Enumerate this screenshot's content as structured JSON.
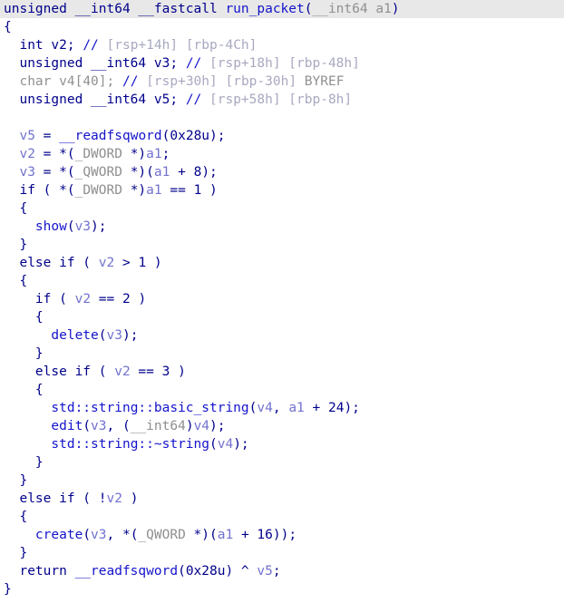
{
  "view": {
    "name": "hex-rays-pseudocode",
    "background": "#ffffff",
    "current_line_highlight": "#e8e8e8",
    "font_size_px": 14.5,
    "line_height_px": 20
  },
  "colors": {
    "keyword": "#00008b",
    "number": "#00008b",
    "punctuation": "#00008b",
    "function": "#1414cc",
    "variable": "#7272cf",
    "pseudotype": "#8f8f8f",
    "comment": "#a8a8c0",
    "dimmed": "#909090"
  },
  "function": {
    "return_type": "unsigned __int64",
    "calling_convention": "__fastcall",
    "name": "run_packet",
    "parameter": "__int64 a1"
  },
  "lines": [
    {
      "n": 1,
      "current": true,
      "tokens": [
        {
          "t": "unsigned __int64 ",
          "c": "kw"
        },
        {
          "t": "__fastcall ",
          "c": "kw"
        },
        {
          "t": "run_packet",
          "c": "fn"
        },
        {
          "t": "(",
          "c": "punc"
        },
        {
          "t": "__int64 ",
          "c": "dim"
        },
        {
          "t": "a1",
          "c": "dim"
        },
        {
          "t": ")",
          "c": "punc"
        }
      ]
    },
    {
      "n": 2,
      "current": false,
      "tokens": [
        {
          "t": "{",
          "c": "punc"
        }
      ]
    },
    {
      "n": 3,
      "current": false,
      "tokens": [
        {
          "t": "  ",
          "c": "plain"
        },
        {
          "t": "int ",
          "c": "kw"
        },
        {
          "t": "v2",
          "c": "kw"
        },
        {
          "t": "; ",
          "c": "punc"
        },
        {
          "t": "//",
          "c": "fn"
        },
        {
          "t": " [rsp+14h] [rbp-4Ch]",
          "c": "cmt"
        }
      ]
    },
    {
      "n": 4,
      "current": false,
      "tokens": [
        {
          "t": "  ",
          "c": "plain"
        },
        {
          "t": "unsigned __int64 ",
          "c": "kw"
        },
        {
          "t": "v3",
          "c": "kw"
        },
        {
          "t": "; ",
          "c": "punc"
        },
        {
          "t": "//",
          "c": "fn"
        },
        {
          "t": " [rsp+18h] [rbp-48h]",
          "c": "cmt"
        }
      ]
    },
    {
      "n": 5,
      "current": false,
      "tokens": [
        {
          "t": "  ",
          "c": "plain"
        },
        {
          "t": "char ",
          "c": "dim"
        },
        {
          "t": "v4[40]",
          "c": "dim"
        },
        {
          "t": "; ",
          "c": "dim"
        },
        {
          "t": "//",
          "c": "fn"
        },
        {
          "t": " [rsp+30h] [rbp-30h] ",
          "c": "cmt"
        },
        {
          "t": "BYREF",
          "c": "dim"
        }
      ]
    },
    {
      "n": 6,
      "current": false,
      "tokens": [
        {
          "t": "  ",
          "c": "plain"
        },
        {
          "t": "unsigned __int64 ",
          "c": "kw"
        },
        {
          "t": "v5",
          "c": "kw"
        },
        {
          "t": "; ",
          "c": "punc"
        },
        {
          "t": "//",
          "c": "fn"
        },
        {
          "t": " [rsp+58h] [rbp-8h]",
          "c": "cmt"
        }
      ]
    },
    {
      "n": 7,
      "current": false,
      "tokens": [
        {
          "t": "",
          "c": "plain"
        }
      ]
    },
    {
      "n": 8,
      "current": false,
      "tokens": [
        {
          "t": "  ",
          "c": "plain"
        },
        {
          "t": "v5",
          "c": "var"
        },
        {
          "t": " = ",
          "c": "punc"
        },
        {
          "t": "__readfsqword",
          "c": "fn"
        },
        {
          "t": "(",
          "c": "punc"
        },
        {
          "t": "0x28u",
          "c": "num"
        },
        {
          "t": ");",
          "c": "punc"
        }
      ]
    },
    {
      "n": 9,
      "current": false,
      "tokens": [
        {
          "t": "  ",
          "c": "plain"
        },
        {
          "t": "v2",
          "c": "var"
        },
        {
          "t": " = *(",
          "c": "punc"
        },
        {
          "t": "_DWORD ",
          "c": "type"
        },
        {
          "t": "*)",
          "c": "punc"
        },
        {
          "t": "a1",
          "c": "var"
        },
        {
          "t": ";",
          "c": "punc"
        }
      ]
    },
    {
      "n": 10,
      "current": false,
      "tokens": [
        {
          "t": "  ",
          "c": "plain"
        },
        {
          "t": "v3",
          "c": "var"
        },
        {
          "t": " = *(",
          "c": "punc"
        },
        {
          "t": "_QWORD ",
          "c": "type"
        },
        {
          "t": "*)(",
          "c": "punc"
        },
        {
          "t": "a1",
          "c": "var"
        },
        {
          "t": " + ",
          "c": "punc"
        },
        {
          "t": "8",
          "c": "num"
        },
        {
          "t": ");",
          "c": "punc"
        }
      ]
    },
    {
      "n": 11,
      "current": false,
      "tokens": [
        {
          "t": "  ",
          "c": "plain"
        },
        {
          "t": "if",
          "c": "kw"
        },
        {
          "t": " ( *(",
          "c": "punc"
        },
        {
          "t": "_DWORD ",
          "c": "type"
        },
        {
          "t": "*)",
          "c": "punc"
        },
        {
          "t": "a1",
          "c": "var"
        },
        {
          "t": " == ",
          "c": "punc"
        },
        {
          "t": "1",
          "c": "num"
        },
        {
          "t": " )",
          "c": "punc"
        }
      ]
    },
    {
      "n": 12,
      "current": false,
      "tokens": [
        {
          "t": "  ",
          "c": "plain"
        },
        {
          "t": "{",
          "c": "punc"
        }
      ]
    },
    {
      "n": 13,
      "current": false,
      "tokens": [
        {
          "t": "    ",
          "c": "plain"
        },
        {
          "t": "show",
          "c": "fn"
        },
        {
          "t": "(",
          "c": "punc"
        },
        {
          "t": "v3",
          "c": "var"
        },
        {
          "t": ");",
          "c": "punc"
        }
      ]
    },
    {
      "n": 14,
      "current": false,
      "tokens": [
        {
          "t": "  ",
          "c": "plain"
        },
        {
          "t": "}",
          "c": "punc"
        }
      ]
    },
    {
      "n": 15,
      "current": false,
      "tokens": [
        {
          "t": "  ",
          "c": "plain"
        },
        {
          "t": "else if",
          "c": "kw"
        },
        {
          "t": " ( ",
          "c": "punc"
        },
        {
          "t": "v2",
          "c": "var"
        },
        {
          "t": " > ",
          "c": "punc"
        },
        {
          "t": "1",
          "c": "num"
        },
        {
          "t": " )",
          "c": "punc"
        }
      ]
    },
    {
      "n": 16,
      "current": false,
      "tokens": [
        {
          "t": "  ",
          "c": "plain"
        },
        {
          "t": "{",
          "c": "punc"
        }
      ]
    },
    {
      "n": 17,
      "current": false,
      "tokens": [
        {
          "t": "    ",
          "c": "plain"
        },
        {
          "t": "if",
          "c": "kw"
        },
        {
          "t": " ( ",
          "c": "punc"
        },
        {
          "t": "v2",
          "c": "var"
        },
        {
          "t": " == ",
          "c": "punc"
        },
        {
          "t": "2",
          "c": "num"
        },
        {
          "t": " )",
          "c": "punc"
        }
      ]
    },
    {
      "n": 18,
      "current": false,
      "tokens": [
        {
          "t": "    ",
          "c": "plain"
        },
        {
          "t": "{",
          "c": "punc"
        }
      ]
    },
    {
      "n": 19,
      "current": false,
      "tokens": [
        {
          "t": "      ",
          "c": "plain"
        },
        {
          "t": "delete",
          "c": "fn"
        },
        {
          "t": "(",
          "c": "punc"
        },
        {
          "t": "v3",
          "c": "var"
        },
        {
          "t": ");",
          "c": "punc"
        }
      ]
    },
    {
      "n": 20,
      "current": false,
      "tokens": [
        {
          "t": "    ",
          "c": "plain"
        },
        {
          "t": "}",
          "c": "punc"
        }
      ]
    },
    {
      "n": 21,
      "current": false,
      "tokens": [
        {
          "t": "    ",
          "c": "plain"
        },
        {
          "t": "else if",
          "c": "kw"
        },
        {
          "t": " ( ",
          "c": "punc"
        },
        {
          "t": "v2",
          "c": "var"
        },
        {
          "t": " == ",
          "c": "punc"
        },
        {
          "t": "3",
          "c": "num"
        },
        {
          "t": " )",
          "c": "punc"
        }
      ]
    },
    {
      "n": 22,
      "current": false,
      "tokens": [
        {
          "t": "    ",
          "c": "plain"
        },
        {
          "t": "{",
          "c": "punc"
        }
      ]
    },
    {
      "n": 23,
      "current": false,
      "tokens": [
        {
          "t": "      ",
          "c": "plain"
        },
        {
          "t": "std::string::basic_string",
          "c": "fn"
        },
        {
          "t": "(",
          "c": "punc"
        },
        {
          "t": "v4",
          "c": "var"
        },
        {
          "t": ", ",
          "c": "punc"
        },
        {
          "t": "a1",
          "c": "var"
        },
        {
          "t": " + ",
          "c": "punc"
        },
        {
          "t": "24",
          "c": "num"
        },
        {
          "t": ");",
          "c": "punc"
        }
      ]
    },
    {
      "n": 24,
      "current": false,
      "tokens": [
        {
          "t": "      ",
          "c": "plain"
        },
        {
          "t": "edit",
          "c": "fn"
        },
        {
          "t": "(",
          "c": "punc"
        },
        {
          "t": "v3",
          "c": "var"
        },
        {
          "t": ", (",
          "c": "punc"
        },
        {
          "t": "__int64",
          "c": "type"
        },
        {
          "t": ")",
          "c": "punc"
        },
        {
          "t": "v4",
          "c": "var"
        },
        {
          "t": ");",
          "c": "punc"
        }
      ]
    },
    {
      "n": 25,
      "current": false,
      "tokens": [
        {
          "t": "      ",
          "c": "plain"
        },
        {
          "t": "std::string::~string",
          "c": "fn"
        },
        {
          "t": "(",
          "c": "punc"
        },
        {
          "t": "v4",
          "c": "var"
        },
        {
          "t": ");",
          "c": "punc"
        }
      ]
    },
    {
      "n": 26,
      "current": false,
      "tokens": [
        {
          "t": "    ",
          "c": "plain"
        },
        {
          "t": "}",
          "c": "punc"
        }
      ]
    },
    {
      "n": 27,
      "current": false,
      "tokens": [
        {
          "t": "  ",
          "c": "plain"
        },
        {
          "t": "}",
          "c": "punc"
        }
      ]
    },
    {
      "n": 28,
      "current": false,
      "tokens": [
        {
          "t": "  ",
          "c": "plain"
        },
        {
          "t": "else if",
          "c": "kw"
        },
        {
          "t": " ( !",
          "c": "punc"
        },
        {
          "t": "v2",
          "c": "var"
        },
        {
          "t": " )",
          "c": "punc"
        }
      ]
    },
    {
      "n": 29,
      "current": false,
      "tokens": [
        {
          "t": "  ",
          "c": "plain"
        },
        {
          "t": "{",
          "c": "punc"
        }
      ]
    },
    {
      "n": 30,
      "current": false,
      "tokens": [
        {
          "t": "    ",
          "c": "plain"
        },
        {
          "t": "create",
          "c": "fn"
        },
        {
          "t": "(",
          "c": "punc"
        },
        {
          "t": "v3",
          "c": "var"
        },
        {
          "t": ", *(",
          "c": "punc"
        },
        {
          "t": "_QWORD ",
          "c": "type"
        },
        {
          "t": "*)(",
          "c": "punc"
        },
        {
          "t": "a1",
          "c": "var"
        },
        {
          "t": " + ",
          "c": "punc"
        },
        {
          "t": "16",
          "c": "num"
        },
        {
          "t": "));",
          "c": "punc"
        }
      ]
    },
    {
      "n": 31,
      "current": false,
      "tokens": [
        {
          "t": "  ",
          "c": "plain"
        },
        {
          "t": "}",
          "c": "punc"
        }
      ]
    },
    {
      "n": 32,
      "current": false,
      "tokens": [
        {
          "t": "  ",
          "c": "plain"
        },
        {
          "t": "return ",
          "c": "kw"
        },
        {
          "t": "__readfsqword",
          "c": "fn"
        },
        {
          "t": "(",
          "c": "punc"
        },
        {
          "t": "0x28u",
          "c": "num"
        },
        {
          "t": ") ^ ",
          "c": "punc"
        },
        {
          "t": "v5",
          "c": "var"
        },
        {
          "t": ";",
          "c": "punc"
        }
      ]
    },
    {
      "n": 33,
      "current": false,
      "tokens": [
        {
          "t": "}",
          "c": "punc"
        }
      ]
    }
  ]
}
